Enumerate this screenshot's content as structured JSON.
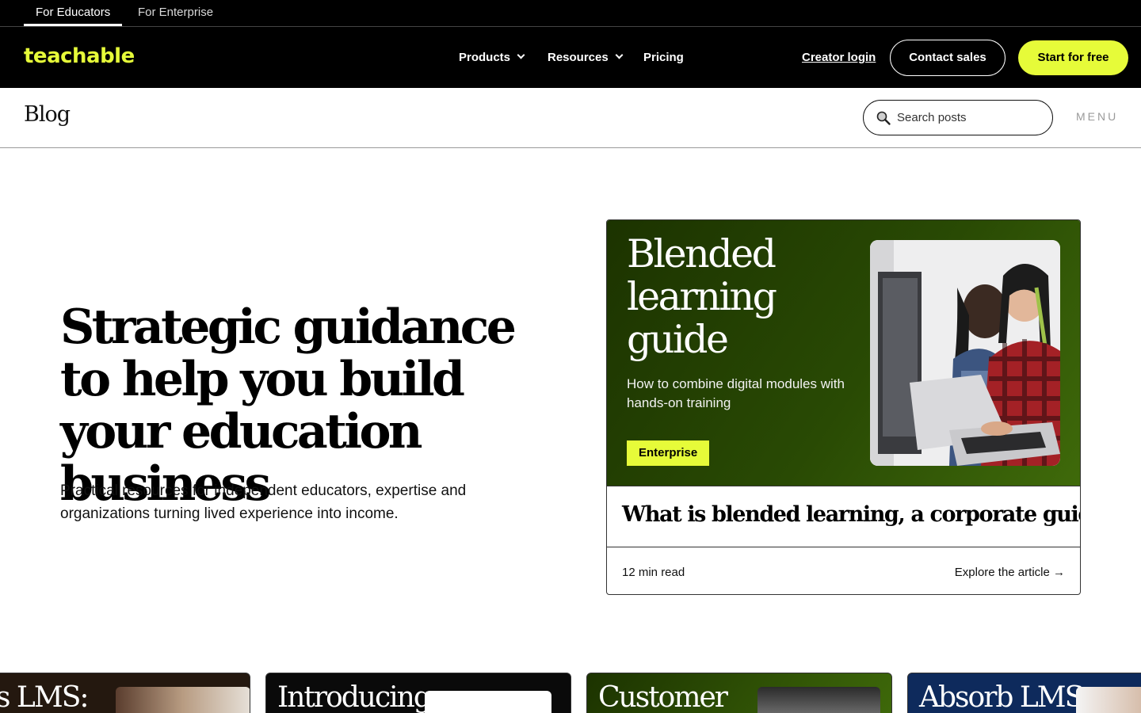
{
  "audience_tabs": [
    {
      "label": "For Educators",
      "active": true
    },
    {
      "label": "For Enterprise",
      "active": false
    }
  ],
  "brand": {
    "logo_text": "teachable",
    "accent": "#e6fb39"
  },
  "nav": {
    "products": "Products",
    "resources": "Resources",
    "pricing": "Pricing",
    "creator_login": "Creator login",
    "contact_sales": "Contact sales",
    "start_free": "Start for free"
  },
  "blog": {
    "title": "Blog",
    "search_placeholder": "Search posts",
    "menu_label": "MENU"
  },
  "hero": {
    "heading": "Strategic guidance to help you build your education business",
    "subheading": "Practical resources for independent educators, expertise and organizations turning lived experience into income."
  },
  "featured": {
    "banner_title": "Blended learning guide",
    "banner_subtitle": "How to combine digital modules with hands-on training",
    "tag": "Enterprise",
    "title": "What is blended learning, a corporate guide",
    "read_time": "12 min read",
    "cta": "Explore the article →"
  },
  "article_cards": [
    {
      "title": "P vs LMS:",
      "bg": "#2a1f1a"
    },
    {
      "title": "Introducing",
      "bg": "#0a0a0a"
    },
    {
      "title": "Customer",
      "bg": "#2b3a0a"
    },
    {
      "title": "Absorb LMS",
      "bg": "#0e2a5c"
    }
  ]
}
